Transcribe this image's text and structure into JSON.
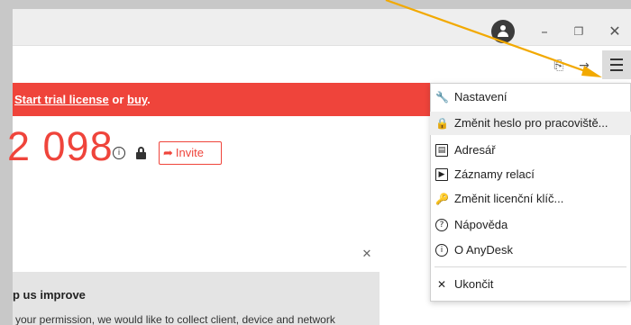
{
  "titlebar": {
    "minimize": "–",
    "restore": "❐",
    "close": "✕"
  },
  "toolbar": {
    "share_icon": "⎘",
    "forward_icon": "→",
    "menu_icon": "hamburger-icon"
  },
  "banner": {
    "prefix": "",
    "trial_link": "Start trial license",
    "middle": " or ",
    "buy_link": "buy",
    "suffix": "."
  },
  "desk": {
    "id_partial": "2 098",
    "invite_label": "Invite"
  },
  "panel": {
    "close": "✕",
    "title": "p us improve",
    "text": "your permission, we would like to collect client, device and network"
  },
  "menu": {
    "items": [
      {
        "label": "Nastavení",
        "icon": "wrench-icon",
        "glyph": "🔧"
      },
      {
        "label": "Změnit heslo pro pracoviště...",
        "icon": "lock-icon",
        "glyph": "🔒"
      },
      {
        "label": "Adresář",
        "icon": "address-book-icon",
        "glyph": "▤"
      },
      {
        "label": "Záznamy relací",
        "icon": "play-icon",
        "glyph": "▶"
      },
      {
        "label": "Změnit licenční klíč...",
        "icon": "key-icon",
        "glyph": "🔑"
      },
      {
        "label": "Nápověda",
        "icon": "help-icon",
        "glyph": "?"
      },
      {
        "label": "O AnyDesk",
        "icon": "info-icon",
        "glyph": "i"
      },
      {
        "label": "Ukončit",
        "icon": "exit-icon",
        "glyph": "✕"
      }
    ]
  },
  "colors": {
    "accent_red": "#ef443b",
    "annotation_arrow": "#f2a900"
  }
}
